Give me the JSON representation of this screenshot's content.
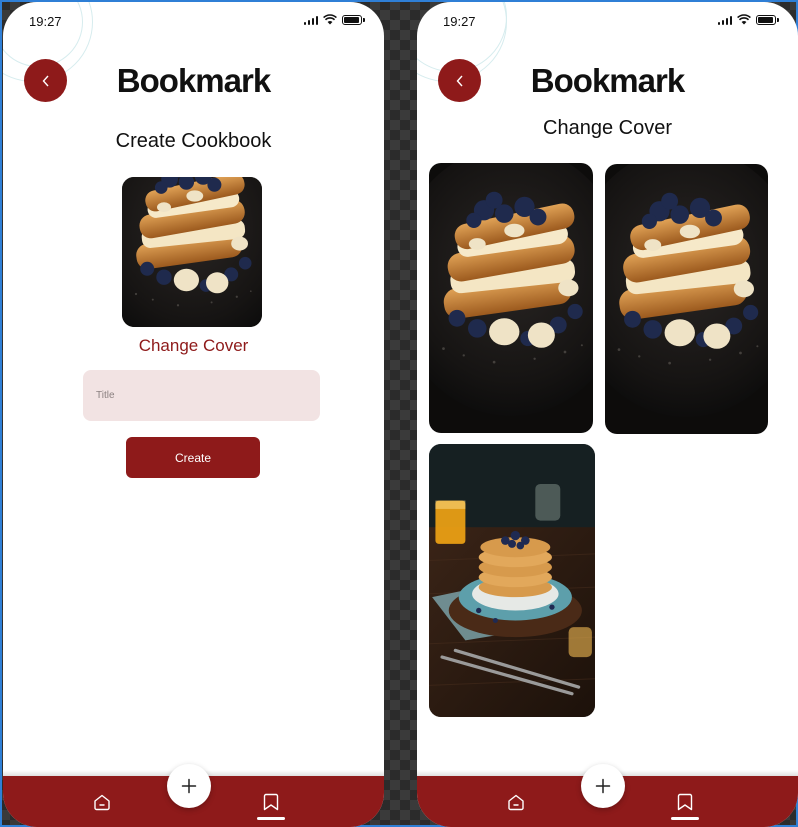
{
  "status_bar": {
    "time": "19:27"
  },
  "app": {
    "title": "Bookmark"
  },
  "create_screen": {
    "heading": "Create Cookbook",
    "change_cover_label": "Change Cover",
    "title_field": {
      "placeholder": "Title",
      "value": ""
    },
    "create_button_label": "Create"
  },
  "change_cover_screen": {
    "heading": "Change Cover",
    "cover_options": [
      {
        "image": "french-toast-berries-photo"
      },
      {
        "image": "french-toast-berries-photo"
      },
      {
        "image": "blueberry-pancakes-photo"
      }
    ]
  },
  "bottom_nav": {
    "items": [
      {
        "icon": "home-icon"
      },
      {
        "icon": "add-icon"
      },
      {
        "icon": "bookmark-icon",
        "active": true
      }
    ]
  },
  "colors": {
    "brand": "#8e1a1a",
    "field_bg": "#f2e3e3",
    "background": "#ffffff"
  }
}
